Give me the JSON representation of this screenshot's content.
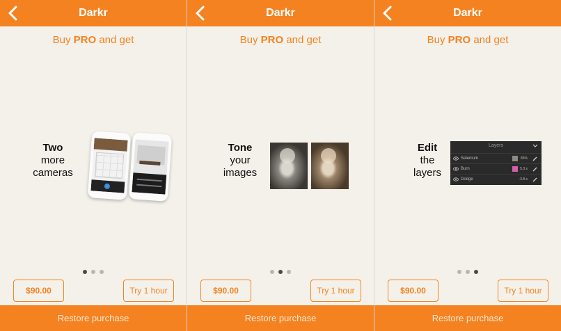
{
  "app": {
    "title": "Darkr"
  },
  "subtitle": {
    "prefix": "Buy ",
    "pro": "PRO",
    "suffix": " and get"
  },
  "panels": [
    {
      "feature_lines": [
        "Two",
        "more",
        "cameras"
      ],
      "active_dot": 0,
      "illustration": "two-phones-camera-screens"
    },
    {
      "feature_lines": [
        "Tone",
        "your",
        "images"
      ],
      "active_dot": 1,
      "illustration": "two-toned-photos"
    },
    {
      "feature_lines": [
        "Edit",
        "the",
        "layers"
      ],
      "active_dot": 2,
      "illustration": "layers-panel",
      "layers": {
        "title": "Layers",
        "rows": [
          {
            "name": "Selenium",
            "value": "85%",
            "swatch": "#8d8a86"
          },
          {
            "name": "Burn",
            "value": "5.3 s",
            "swatch": "#d35fa8"
          },
          {
            "name": "Dodge",
            "value": "-3.8 s",
            "swatch": ""
          }
        ]
      }
    }
  ],
  "buttons": {
    "price": "$90.00",
    "try": "Try 1 hour"
  },
  "footer": {
    "restore": "Restore purchase"
  },
  "colors": {
    "accent": "#f58220",
    "background": "#f4f1ea",
    "dot_active": "#4a4a4a",
    "dot_inactive": "#b9b6b0"
  },
  "icons": {
    "back": "chevron-left-icon",
    "eye": "eye-icon",
    "brush": "brush-icon",
    "chevron": "chevron-down-icon"
  },
  "dots_count": 3
}
